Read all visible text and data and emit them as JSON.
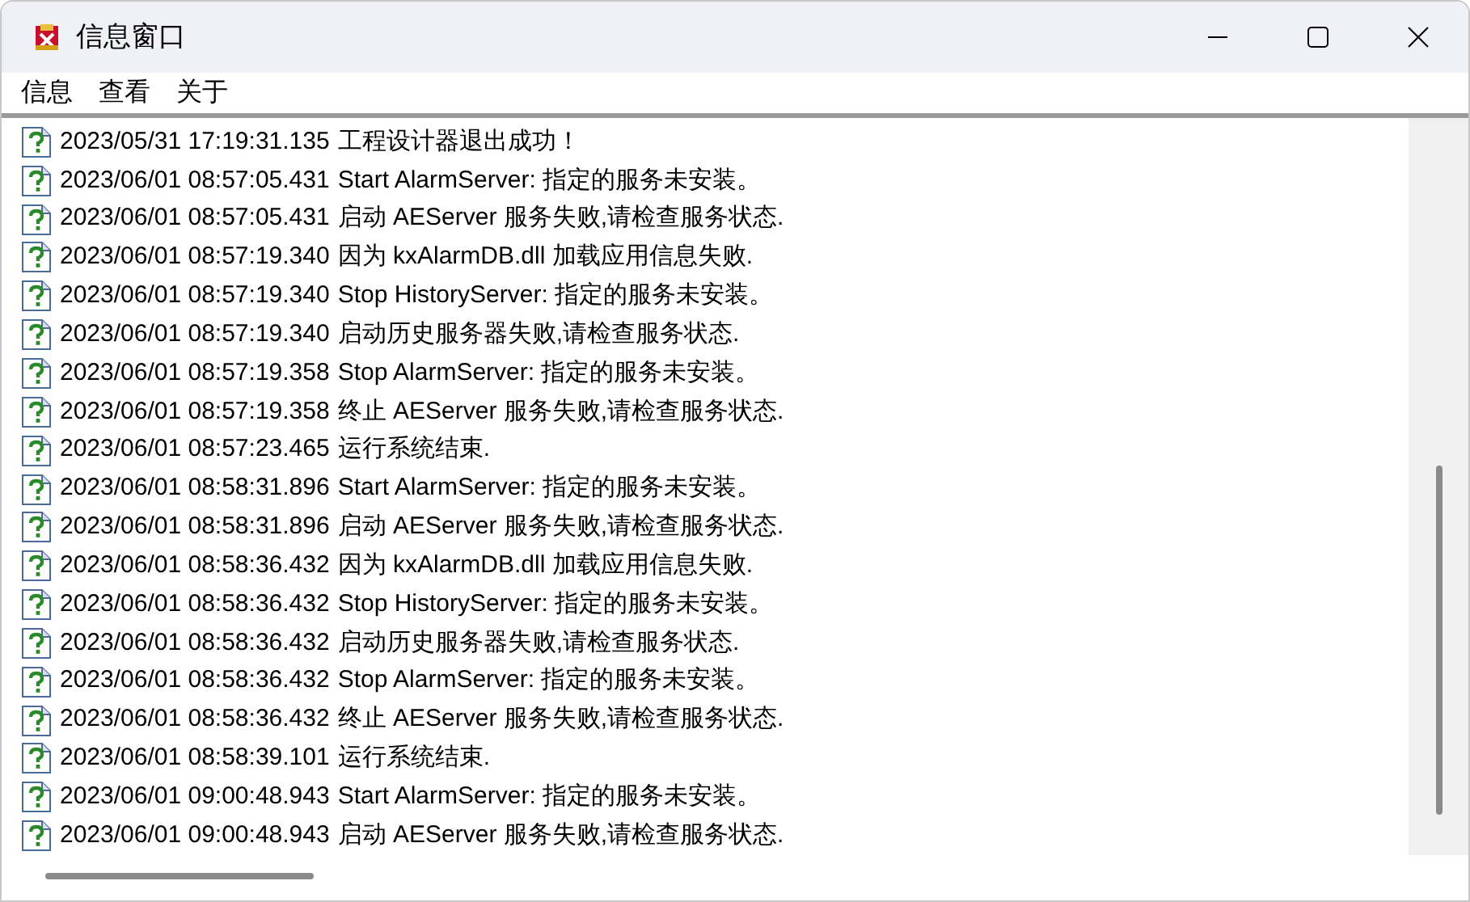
{
  "window": {
    "title": "信息窗口"
  },
  "menu": [
    "信息",
    "查看",
    "关于"
  ],
  "log": [
    {
      "time": "2023/05/31 17:19:31.135",
      "message": "工程设计器退出成功！"
    },
    {
      "time": "2023/06/01 08:57:05.431",
      "message": "Start AlarmServer: 指定的服务未安装。"
    },
    {
      "time": "2023/06/01 08:57:05.431",
      "message": "启动 AEServer 服务失败,请检查服务状态."
    },
    {
      "time": "2023/06/01 08:57:19.340",
      "message": "因为 kxAlarmDB.dll 加载应用信息失败."
    },
    {
      "time": "2023/06/01 08:57:19.340",
      "message": "Stop HistoryServer: 指定的服务未安装。"
    },
    {
      "time": "2023/06/01 08:57:19.340",
      "message": "启动历史服务器失败,请检查服务状态."
    },
    {
      "time": "2023/06/01 08:57:19.358",
      "message": "Stop AlarmServer: 指定的服务未安装。"
    },
    {
      "time": "2023/06/01 08:57:19.358",
      "message": "终止 AEServer 服务失败,请检查服务状态."
    },
    {
      "time": "2023/06/01 08:57:23.465",
      "message": "运行系统结束."
    },
    {
      "time": "2023/06/01 08:58:31.896",
      "message": "Start AlarmServer: 指定的服务未安装。"
    },
    {
      "time": "2023/06/01 08:58:31.896",
      "message": "启动 AEServer 服务失败,请检查服务状态."
    },
    {
      "time": "2023/06/01 08:58:36.432",
      "message": "因为 kxAlarmDB.dll 加载应用信息失败."
    },
    {
      "time": "2023/06/01 08:58:36.432",
      "message": "Stop HistoryServer: 指定的服务未安装。"
    },
    {
      "time": "2023/06/01 08:58:36.432",
      "message": "启动历史服务器失败,请检查服务状态."
    },
    {
      "time": "2023/06/01 08:58:36.432",
      "message": "Stop AlarmServer: 指定的服务未安装。"
    },
    {
      "time": "2023/06/01 08:58:36.432",
      "message": "终止 AEServer 服务失败,请检查服务状态."
    },
    {
      "time": "2023/06/01 08:58:39.101",
      "message": "运行系统结束."
    },
    {
      "time": "2023/06/01 09:00:48.943",
      "message": "Start AlarmServer: 指定的服务未安装。"
    },
    {
      "time": "2023/06/01 09:00:48.943",
      "message": "启动 AEServer 服务失败,请检查服务状态."
    }
  ]
}
